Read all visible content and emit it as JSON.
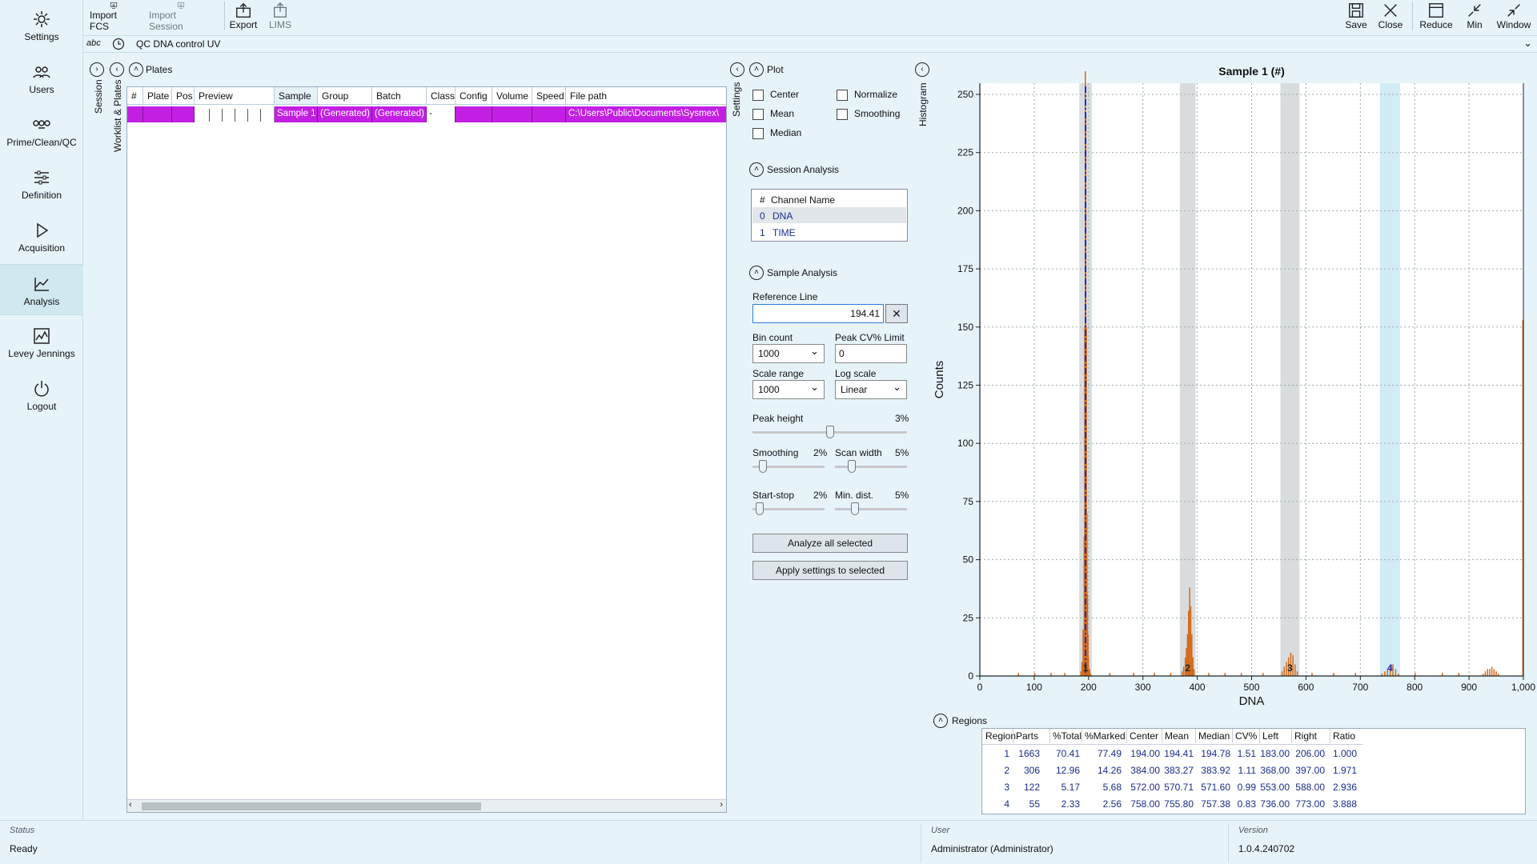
{
  "sidebar": {
    "items": [
      {
        "label": "Settings",
        "icon": "gear-icon"
      },
      {
        "label": "Users",
        "icon": "users-icon"
      },
      {
        "label": "Prime/Clean/QC",
        "icon": "prime-icon"
      },
      {
        "label": "Definition",
        "icon": "sliders-icon"
      },
      {
        "label": "Acquisition",
        "icon": "play-icon"
      },
      {
        "label": "Analysis",
        "icon": "analysis-icon"
      },
      {
        "label": "Levey Jennings",
        "icon": "levey-icon"
      },
      {
        "label": "Logout",
        "icon": "power-icon"
      }
    ]
  },
  "toolbar": {
    "import_fcs": "Import FCS",
    "import_session": "Import Session",
    "export": "Export",
    "lims": "LIMS",
    "save": "Save",
    "close": "Close",
    "reduce": "Reduce",
    "min": "Min",
    "window": "Window"
  },
  "pathbar": {
    "abc": "abc",
    "text": "QC DNA control UV"
  },
  "side_tabs": {
    "session": "Session",
    "worklist": "Worklist & Plates",
    "settings": "Settings",
    "histogram": "Histogram"
  },
  "plates": {
    "title": "Plates",
    "columns": [
      "#",
      "Plate",
      "Pos",
      "Preview",
      "Sample",
      "Group",
      "Batch",
      "Class",
      "Config",
      "Volume",
      "Speed",
      "File path"
    ],
    "row": {
      "num": "",
      "plate": "",
      "pos": "",
      "preview": "",
      "sample": "Sample 1",
      "group": "(Generated)",
      "batch": "(Generated)",
      "class": "-",
      "config": "",
      "volume": "",
      "speed": "",
      "filepath": "C:\\Users\\Public\\Documents\\Sysmex\\"
    }
  },
  "plot": {
    "title": "Plot",
    "center": "Center",
    "mean": "Mean",
    "median": "Median",
    "normalize": "Normalize",
    "smoothing": "Smoothing"
  },
  "session_analysis": {
    "title": "Session Analysis",
    "hash": "#",
    "col": "Channel Name",
    "channels": [
      {
        "num": "0",
        "name": "DNA"
      },
      {
        "num": "1",
        "name": "TIME"
      }
    ]
  },
  "sample_analysis": {
    "title": "Sample Analysis",
    "ref_label": "Reference Line",
    "ref_value": "194.41",
    "bin_label": "Bin count",
    "bin_value": "1000",
    "cv_label": "Peak CV% Limit",
    "cv_value": "0",
    "scale_label": "Scale range",
    "scale_value": "1000",
    "log_label": "Log scale",
    "log_value": "Linear",
    "peak_label": "Peak height",
    "peak_pct": "3%",
    "peak_level": 0.5,
    "smooth_label": "Smoothing",
    "smooth_pct": "2%",
    "smooth_level": 0.1,
    "scan_label": "Scan width",
    "scan_pct": "5%",
    "scan_level": 0.2,
    "start_label": "Start-stop",
    "start_pct": "2%",
    "start_level": 0.05,
    "mind_label": "Min. dist.",
    "mind_pct": "5%",
    "mind_level": 0.25,
    "analyze_btn": "Analyze all selected",
    "apply_btn": "Apply settings to selected"
  },
  "chart_data": {
    "type": "bar",
    "title": "Sample 1 (#)",
    "xlabel": "DNA",
    "ylabel": "Counts",
    "xlim": [
      0,
      1000
    ],
    "ylim": [
      0,
      250
    ],
    "xticks": [
      "0",
      "100",
      "200",
      "300",
      "400",
      "500",
      "600",
      "700",
      "800",
      "900",
      "1,000"
    ],
    "yticks": [
      "0",
      "25",
      "50",
      "75",
      "100",
      "125",
      "150",
      "175",
      "200",
      "225",
      "250"
    ],
    "reference_line": 194.41,
    "regions": [
      {
        "left": 183,
        "right": 206,
        "label": "1"
      },
      {
        "left": 368,
        "right": 397,
        "label": "2"
      },
      {
        "left": 553,
        "right": 588,
        "label": "3"
      },
      {
        "left": 736,
        "right": 773,
        "label": "4"
      }
    ],
    "peaks": [
      {
        "x": [
          186,
          188,
          190,
          192,
          193,
          194,
          195,
          196,
          197,
          198,
          199,
          200,
          202,
          204
        ],
        "y": [
          2,
          6,
          20,
          60,
          150,
          265,
          240,
          150,
          70,
          35,
          18,
          8,
          3,
          1
        ]
      },
      {
        "x": [
          372,
          375,
          378,
          380,
          382,
          384,
          386,
          388,
          390,
          392,
          394
        ],
        "y": [
          2,
          4,
          8,
          12,
          18,
          28,
          38,
          30,
          18,
          8,
          3
        ]
      },
      {
        "x": [
          556,
          560,
          564,
          568,
          572,
          576,
          580,
          584
        ],
        "y": [
          2,
          4,
          6,
          8,
          10,
          9,
          5,
          2
        ]
      },
      {
        "x": [
          740,
          745,
          750,
          755,
          760,
          765,
          770
        ],
        "y": [
          1,
          2,
          3,
          4,
          5,
          3,
          1
        ]
      },
      {
        "x": [
          926,
          930,
          934,
          938,
          942,
          946,
          950,
          954
        ],
        "y": [
          1,
          2,
          3,
          3,
          4,
          3,
          2,
          1
        ]
      }
    ],
    "noise": [
      {
        "x": 70,
        "y": 1
      },
      {
        "x": 100,
        "y": 1
      },
      {
        "x": 130,
        "y": 1
      },
      {
        "x": 155,
        "y": 1
      },
      {
        "x": 238,
        "y": 1
      },
      {
        "x": 282,
        "y": 1
      },
      {
        "x": 320,
        "y": 1
      },
      {
        "x": 350,
        "y": 1
      },
      {
        "x": 420,
        "y": 1
      },
      {
        "x": 450,
        "y": 1
      },
      {
        "x": 480,
        "y": 1
      },
      {
        "x": 520,
        "y": 1
      },
      {
        "x": 610,
        "y": 1
      },
      {
        "x": 650,
        "y": 1
      },
      {
        "x": 690,
        "y": 1
      },
      {
        "x": 800,
        "y": 1
      },
      {
        "x": 850,
        "y": 1
      },
      {
        "x": 880,
        "y": 1
      }
    ],
    "end_bar": {
      "x": 998,
      "y": 153
    }
  },
  "regions_table": {
    "title": "Regions",
    "headers": [
      "Region",
      "Parts",
      "%Total",
      "%Marked",
      "Center",
      "Mean",
      "Median",
      "CV%",
      "Left",
      "Right",
      "Ratio"
    ],
    "rows": [
      [
        "1",
        "1663",
        "70.41",
        "77.49",
        "194.00",
        "194.41",
        "194.78",
        "1.51",
        "183.00",
        "206.00",
        "1.000"
      ],
      [
        "2",
        "306",
        "12.96",
        "14.26",
        "384.00",
        "383.27",
        "383.92",
        "1.11",
        "368.00",
        "397.00",
        "1.971"
      ],
      [
        "3",
        "122",
        "5.17",
        "5.68",
        "572.00",
        "570.71",
        "571.60",
        "0.99",
        "553.00",
        "588.00",
        "2.936"
      ],
      [
        "4",
        "55",
        "2.33",
        "2.56",
        "758.00",
        "755.80",
        "757.38",
        "0.83",
        "736.00",
        "773.00",
        "3.888"
      ]
    ]
  },
  "status": {
    "status_label": "Status",
    "status_value": "Ready",
    "user_label": "User",
    "user_value": "Administrator  (Administrator)",
    "version_label": "Version",
    "version_value": "1.0.4.240702"
  },
  "colors": {
    "accent_row": "#c31fe3",
    "bar": "#d26a1a",
    "ref_line": "#1c2fc8",
    "region_gray": "#d8dcde",
    "region_blue": "#d0ecf6"
  }
}
